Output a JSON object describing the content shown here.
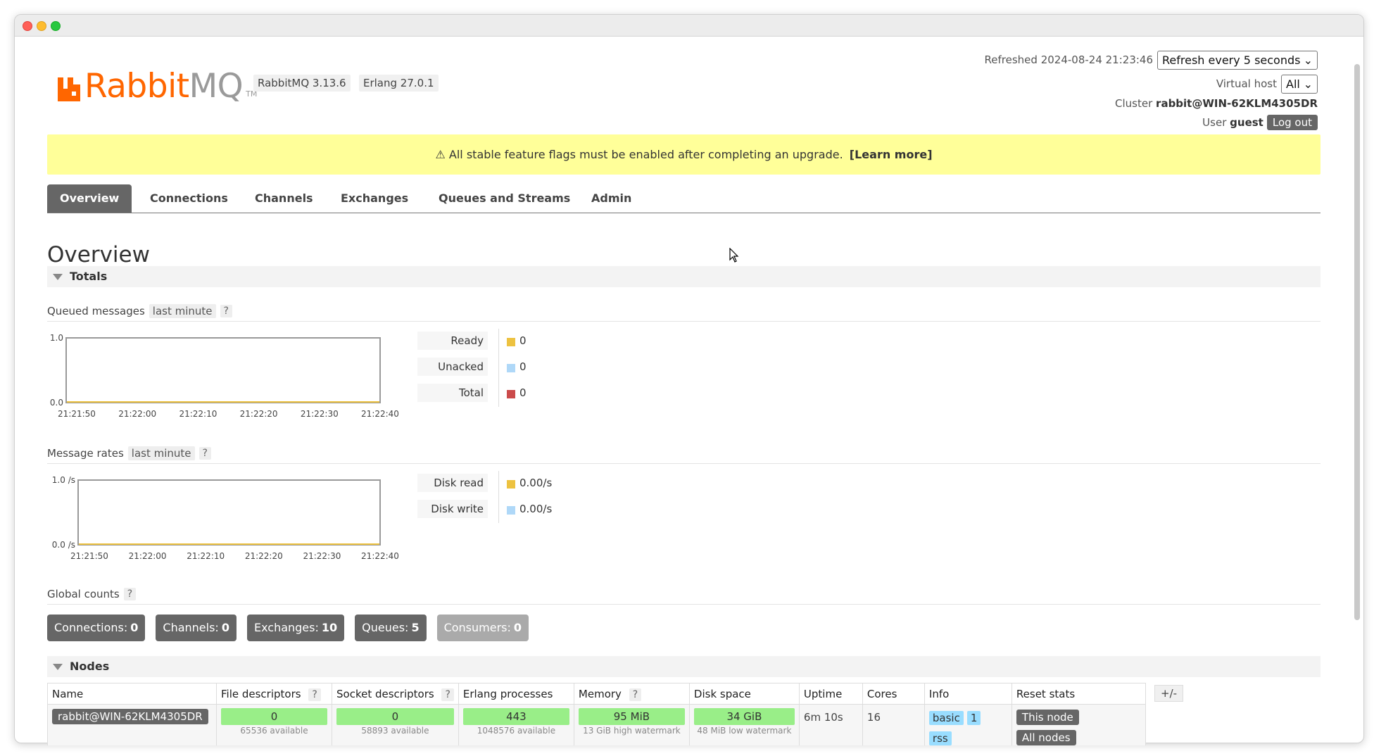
{
  "header": {
    "logo_rabbit": "Rabbit",
    "logo_mq": "MQ",
    "logo_tm": "TM",
    "rabbitmq_version": "RabbitMQ 3.13.6",
    "erlang_version": "Erlang 27.0.1",
    "refreshed_label": "Refreshed",
    "refreshed_time": "2024-08-24 21:23:46",
    "refresh_option": "Refresh every 5 seconds",
    "vhost_label": "Virtual host",
    "vhost_value": "All",
    "cluster_label": "Cluster",
    "cluster_value": "rabbit@WIN-62KLM4305DR",
    "user_label": "User",
    "user_value": "guest",
    "logout_label": "Log out"
  },
  "banner": {
    "icon": "⚠",
    "text": "All stable feature flags must be enabled after completing an upgrade.",
    "link": "[Learn more]"
  },
  "tabs": [
    {
      "label": "Overview",
      "active": true
    },
    {
      "label": "Connections",
      "active": false
    },
    {
      "label": "Channels",
      "active": false
    },
    {
      "label": "Exchanges",
      "active": false
    },
    {
      "label": "Queues and Streams",
      "active": false
    },
    {
      "label": "Admin",
      "active": false
    }
  ],
  "page_title": "Overview",
  "totals": {
    "title": "Totals",
    "queued": {
      "title": "Queued messages",
      "range": "last minute",
      "help": "?",
      "legend": [
        {
          "label": "Ready",
          "value": "0",
          "color": "#edc240"
        },
        {
          "label": "Unacked",
          "value": "0",
          "color": "#afd8f8"
        },
        {
          "label": "Total",
          "value": "0",
          "color": "#cb4b4b"
        }
      ]
    },
    "rates": {
      "title": "Message rates",
      "range": "last minute",
      "help": "?",
      "legend": [
        {
          "label": "Disk read",
          "value": "0.00/s",
          "color": "#edc240"
        },
        {
          "label": "Disk write",
          "value": "0.00/s",
          "color": "#afd8f8"
        }
      ]
    }
  },
  "chart_data": [
    {
      "type": "line",
      "x": [
        "21:21:50",
        "21:22:00",
        "21:22:10",
        "21:22:20",
        "21:22:30",
        "21:22:40"
      ],
      "y_ticks": [
        "1.0",
        "0.0"
      ],
      "ylim": [
        0,
        1
      ],
      "series": [
        {
          "name": "Ready",
          "values": [
            0,
            0,
            0,
            0,
            0,
            0
          ],
          "color": "#edc240"
        },
        {
          "name": "Unacked",
          "values": [
            0,
            0,
            0,
            0,
            0,
            0
          ],
          "color": "#afd8f8"
        },
        {
          "name": "Total",
          "values": [
            0,
            0,
            0,
            0,
            0,
            0
          ],
          "color": "#cb4b4b"
        }
      ],
      "grid": false
    },
    {
      "type": "line",
      "x": [
        "21:21:50",
        "21:22:00",
        "21:22:10",
        "21:22:20",
        "21:22:30",
        "21:22:40"
      ],
      "y_ticks": [
        "1.0 /s",
        "0.0 /s"
      ],
      "ylim": [
        0,
        1
      ],
      "series": [
        {
          "name": "Disk read",
          "values": [
            0,
            0,
            0,
            0,
            0,
            0
          ],
          "color": "#edc240"
        },
        {
          "name": "Disk write",
          "values": [
            0,
            0,
            0,
            0,
            0,
            0
          ],
          "color": "#afd8f8"
        }
      ],
      "grid": false
    }
  ],
  "global_counts": {
    "title": "Global counts",
    "help": "?",
    "items": [
      {
        "label": "Connections:",
        "value": "0",
        "disabled": false
      },
      {
        "label": "Channels:",
        "value": "0",
        "disabled": false
      },
      {
        "label": "Exchanges:",
        "value": "10",
        "disabled": false
      },
      {
        "label": "Queues:",
        "value": "5",
        "disabled": false
      },
      {
        "label": "Consumers:",
        "value": "0",
        "disabled": true
      }
    ]
  },
  "nodes": {
    "title": "Nodes",
    "plusminus": "+/-",
    "columns": {
      "name": "Name",
      "fd": "File descriptors",
      "sd": "Socket descriptors",
      "erl": "Erlang processes",
      "mem": "Memory",
      "disk": "Disk space",
      "uptime": "Uptime",
      "cores": "Cores",
      "info": "Info",
      "reset": "Reset stats",
      "help": "?"
    },
    "row": {
      "name": "rabbit@WIN-62KLM4305DR",
      "fd_value": "0",
      "fd_sub": "65536 available",
      "sd_value": "0",
      "sd_sub": "58893 available",
      "erl_value": "443",
      "erl_sub": "1048576 available",
      "mem_value": "95 MiB",
      "mem_sub": "13 GiB high watermark",
      "disk_value": "34 GiB",
      "disk_sub": "48 MiB low watermark",
      "uptime": "6m 10s",
      "cores": "16",
      "info_tags": [
        "basic",
        "1",
        "rss"
      ],
      "reset_this": "This node",
      "reset_all": "All nodes"
    }
  }
}
